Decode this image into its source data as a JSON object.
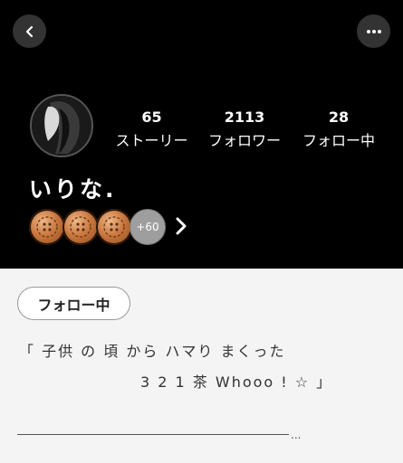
{
  "stats": [
    {
      "value": "65",
      "label": "ストーリー"
    },
    {
      "value": "2113",
      "label": "フォロワー"
    },
    {
      "value": "28",
      "label": "フォロー中"
    }
  ],
  "profile": {
    "name": "いりな."
  },
  "badges": {
    "more_label": "+60"
  },
  "follow_button": {
    "label": "フォロー中"
  },
  "bio": {
    "line1": "「 子供 の 頃 から ハマり まくった",
    "line2": "3 2 1 茶 Whooo ! ☆ 」",
    "trailing": "..."
  },
  "icons": {
    "back": "chevron-left-icon",
    "more": "more-horizontal-icon",
    "expand": "chevron-right-icon"
  },
  "colors": {
    "header_bg": "#000000",
    "page_bg": "#f4f4f4",
    "badge_bronze": "#c8763d",
    "badge_more": "#9e9e9e"
  }
}
